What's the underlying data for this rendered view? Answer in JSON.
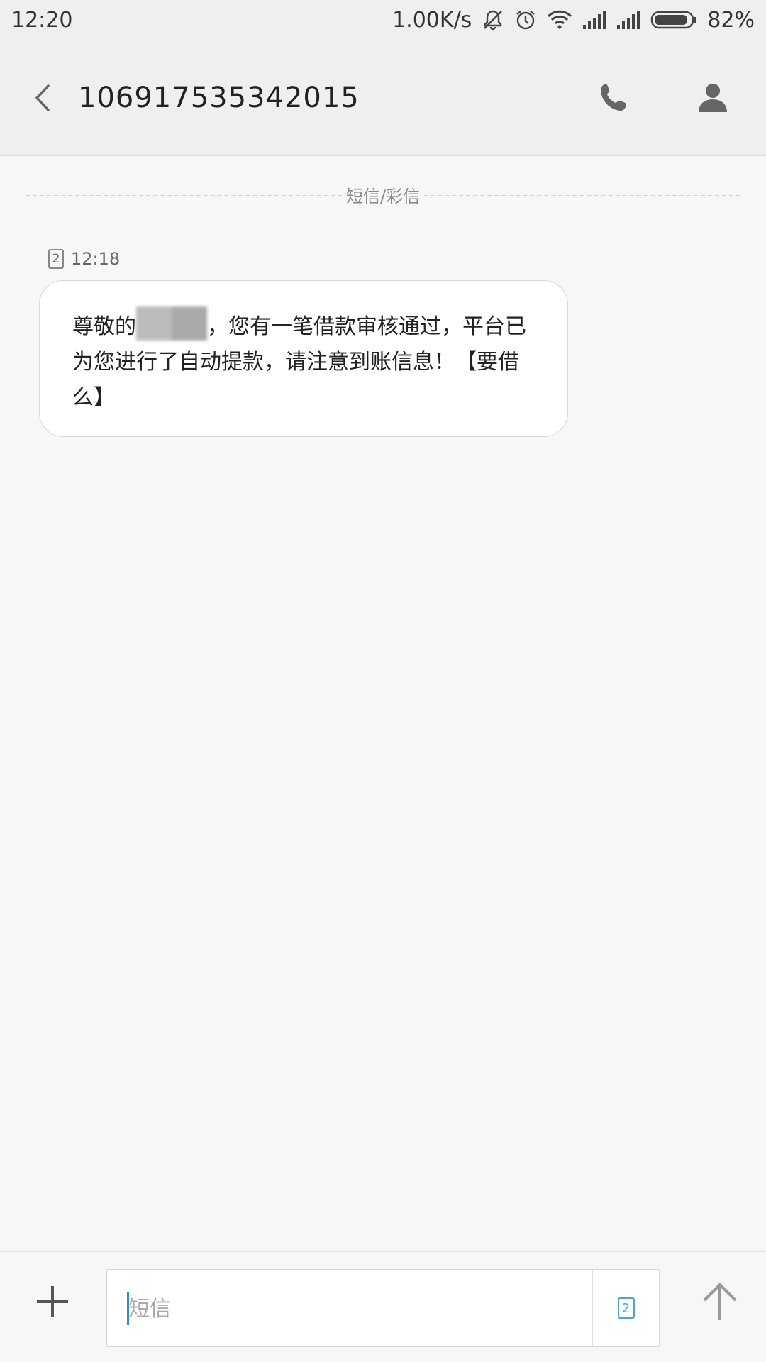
{
  "status_bar": {
    "time": "12:20",
    "network_speed": "1.00K/s",
    "battery_percent": "82%",
    "icons": [
      "mute-icon",
      "alarm-icon",
      "wifi-icon",
      "signal-icon",
      "signal-icon",
      "battery-icon"
    ]
  },
  "header": {
    "title": "106917535342015"
  },
  "conversation": {
    "divider_label": "短信/彩信",
    "messages": [
      {
        "sim": "2",
        "time": "12:18",
        "text_before": "尊敬的",
        "text_after": "，您有一笔借款审核通过，平台已为您进行了自动提款，请注意到账信息！【要借么】"
      }
    ]
  },
  "composer": {
    "placeholder": "短信",
    "sim": "2"
  },
  "colors": {
    "accent": "#2a8fd6",
    "sim_accent": "#4aa6d3",
    "background": "#f7f7f7",
    "header_bg": "#efefef"
  }
}
